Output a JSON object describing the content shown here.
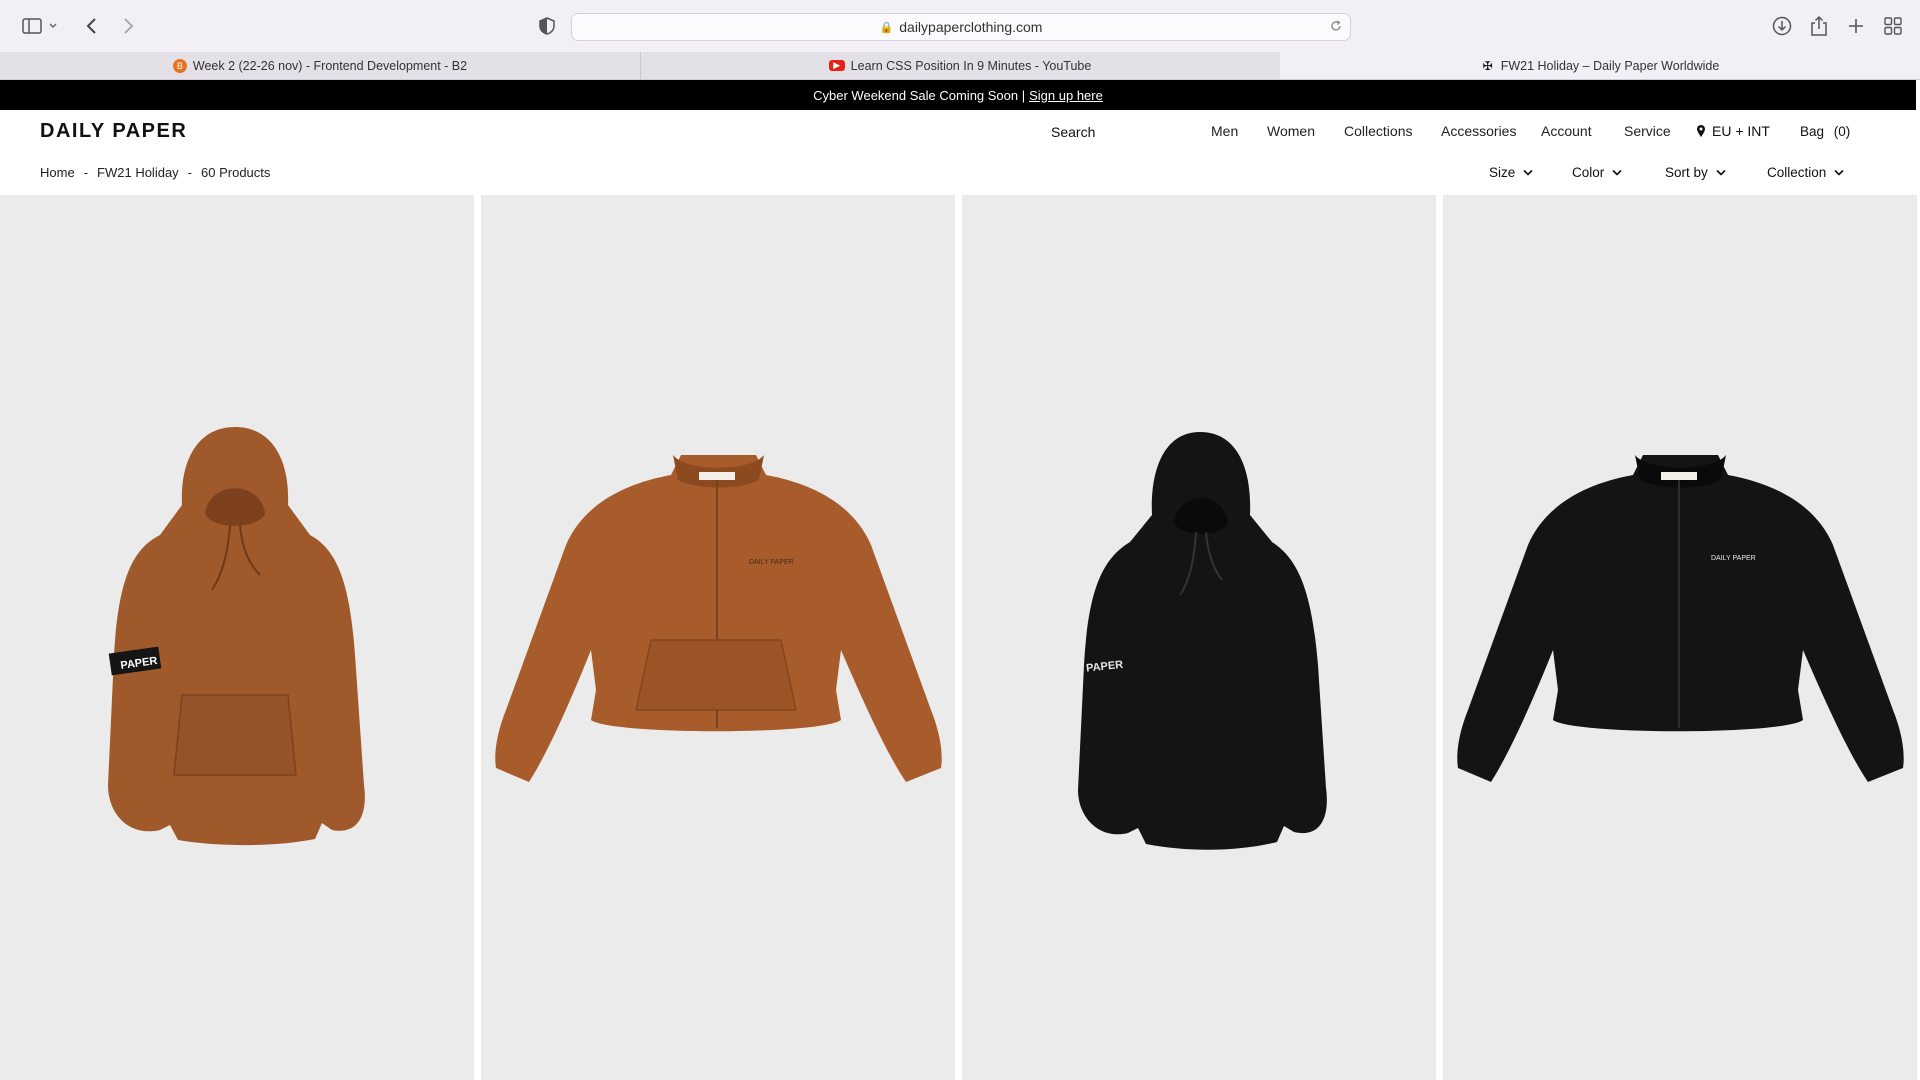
{
  "browser": {
    "url": "dailypaperclothing.com",
    "tabs": [
      {
        "title": "Week 2 (22-26 nov) - Frontend Development - B2",
        "favicon": "orange-circle-icon"
      },
      {
        "title": "Learn CSS Position In 9 Minutes - YouTube",
        "favicon": "youtube-icon"
      },
      {
        "title": "FW21 Holiday – Daily Paper Worldwide",
        "favicon": "daily-paper-icon",
        "active": true
      }
    ]
  },
  "announcement": {
    "text": "Cyber Weekend Sale Coming Soon |",
    "link": "Sign up here"
  },
  "header": {
    "logo": "DAILY PAPER",
    "search": "Search",
    "nav": [
      "Men",
      "Women",
      "Collections",
      "Accessories",
      "Account",
      "Service"
    ],
    "region": "EU + INT",
    "bag_label": "Bag",
    "bag_count": "(0)"
  },
  "breadcrumb": {
    "home": "Home",
    "sep": "-",
    "collection": "FW21 Holiday",
    "count": "60 Products"
  },
  "filters": [
    "Size",
    "Color",
    "Sort by",
    "Collection"
  ],
  "products": [
    {
      "type": "hoodie",
      "color": "#a0592a",
      "badge": "PAPER"
    },
    {
      "type": "jacket",
      "color": "#a85c2c",
      "badge": "DAILY PAPER"
    },
    {
      "type": "hoodie",
      "color": "#141414",
      "badge": "PAPER"
    },
    {
      "type": "jacket",
      "color": "#141414",
      "badge": "DAILY PAPER"
    }
  ],
  "colors": {
    "page_bg": "#ffffff",
    "announce_bg": "#000000",
    "card_bg": "#ebebeb"
  }
}
